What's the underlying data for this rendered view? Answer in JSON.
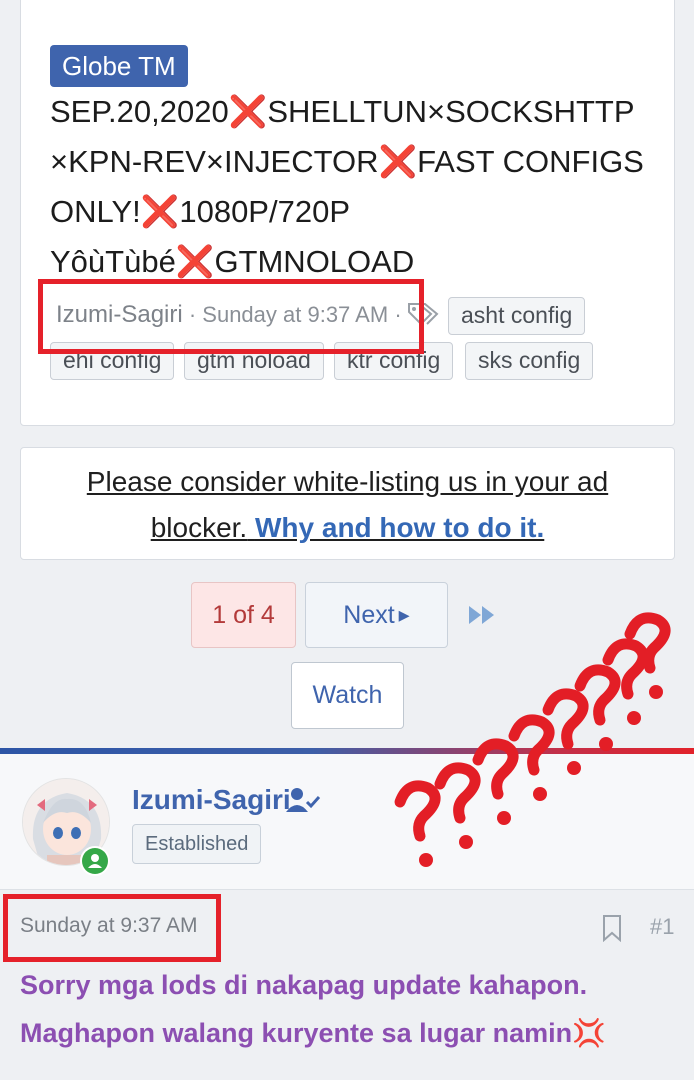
{
  "thread": {
    "prefix": "Globe TM",
    "title_lines": [
      {
        "before": "SEP.20,2020",
        "after": "SHELLTUN×SOCKSHTTP"
      },
      {
        "before": "×KPN-REV×INJECTOR",
        "after": "FAST CONFIGS"
      },
      {
        "before": "ONLY!",
        "after": "1080P/720P"
      },
      {
        "before": "YôùTùbé",
        "after": "GTMNOLOAD"
      }
    ],
    "cross_mark": "❌",
    "author": "Izumi-Sagiri",
    "separator": "·",
    "time": "Sunday at 9:37 AM",
    "tags": [
      "asht config",
      "ehi config",
      "gtm noload",
      "ktr config",
      "sks config"
    ]
  },
  "ad_notice": {
    "line1": "Please consider white-listing us in your ad",
    "line2_text": "blocker.",
    "line2_link": "Why and how to do it."
  },
  "pagination": {
    "current": "1 of 4",
    "next": "Next",
    "next_arrow": "▸",
    "last_icon": "▸▸"
  },
  "watch_label": "Watch",
  "post": {
    "username": "Izumi-Sagiri",
    "user_title": "Established",
    "time": "Sunday at 9:37 AM",
    "number": "#1",
    "body_lines": [
      "Sorry mga lods di nakapag update kahapon.",
      "Maghapon walang kuryente sa lugar namin"
    ],
    "anger_emoji": "💢"
  },
  "colors": {
    "accent": "#3f64ad",
    "annotation_red": "#e5212a",
    "post_text": "#8c4fb2",
    "online": "#35a848"
  },
  "annotation": {
    "question_marks": "??????????"
  }
}
